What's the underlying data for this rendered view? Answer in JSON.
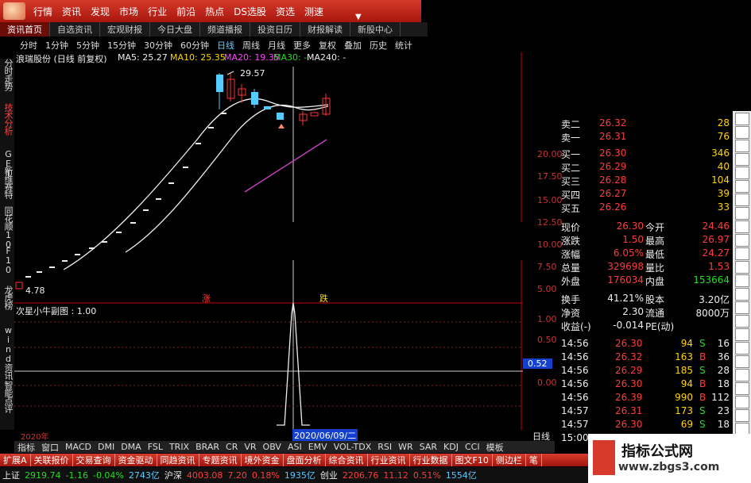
{
  "top_menu": [
    "行情",
    "资讯",
    "发现",
    "市场",
    "行业",
    "前沿",
    "热点",
    "DS选股",
    "资选",
    "测速"
  ],
  "tabs": [
    "资讯首页",
    "自选资讯",
    "宏观财报",
    "今日大盘",
    "频道播报",
    "投资日历",
    "财报解读",
    "新股中心"
  ],
  "toolbar": [
    "分时",
    "1分钟",
    "5分钟",
    "15分钟",
    "30分钟",
    "60分钟",
    "日线",
    "周线",
    "月线",
    "更多",
    "复权",
    "叠加",
    "历史",
    "统计"
  ],
  "toolbar_selected": "日线",
  "sidebar": [
    "分时走势",
    "技术分析",
    "GET",
    "新维赛特",
    "同花顺10",
    "F10",
    "龙虎榜",
    "wind资讯",
    "智能点评"
  ],
  "chart": {
    "stock_title": "浪瑞股份 (日线 前复权)",
    "ma5": "MA5: 25.27",
    "ma10": "MA10: 25.35",
    "ma20": "MA20: 19.35",
    "ma30": "MA30: -",
    "ma240": "MA240: -",
    "high_label": "29.57",
    "low_label": "4.78",
    "right_scale": [
      "20.00",
      "17.50",
      "15.00",
      "12.50",
      "10.00",
      "7.50",
      "5.00"
    ],
    "marker_up": "涨",
    "marker_down": "跌",
    "sub_title": "次星小牛副图 : 1.00",
    "sub_scale": [
      "1.00",
      "0.50",
      "0.00"
    ],
    "sub_value": "0.52",
    "date_left": "2020年",
    "date_cursor": "2020/06/09/二",
    "period_label": "日线"
  },
  "colors": {
    "up": "#ff3b3b",
    "down": "#22dd22",
    "ma10": "#ffd400",
    "ma20": "#ff44ff",
    "ma5": "#eeeeee",
    "brand": "#d63a2a"
  },
  "order_book": [
    {
      "label": "卖二",
      "price": "26.32",
      "vol": "28"
    },
    {
      "label": "卖一",
      "price": "26.31",
      "vol": "76"
    },
    {
      "label": "买一",
      "price": "26.30",
      "vol": "346"
    },
    {
      "label": "买二",
      "price": "26.29",
      "vol": "40"
    },
    {
      "label": "买三",
      "price": "26.28",
      "vol": "104"
    },
    {
      "label": "买四",
      "price": "26.27",
      "vol": "39"
    },
    {
      "label": "买五",
      "price": "26.26",
      "vol": "33"
    }
  ],
  "quote": [
    {
      "l1": "现价",
      "v1": "26.30",
      "l2": "今开",
      "v2": "24.46"
    },
    {
      "l1": "涨跌",
      "v1": "1.50",
      "l2": "最高",
      "v2": "26.97"
    },
    {
      "l1": "涨幅",
      "v1": "6.05%",
      "l2": "最低",
      "v2": "24.27"
    },
    {
      "l1": "总量",
      "v1": "329698",
      "l2": "量比",
      "v2": "1.53"
    },
    {
      "l1": "外盘",
      "v1": "176034",
      "l2": "内盘",
      "v2": "153664"
    }
  ],
  "fund": [
    {
      "l1": "换手",
      "v1": "41.21%",
      "l2": "股本",
      "v2": "3.20亿"
    },
    {
      "l1": "净资",
      "v1": "2.30",
      "l2": "流通",
      "v2": "8000万"
    },
    {
      "l1": "收益(-)",
      "v1": "-0.014",
      "l2": "PE(动)",
      "v2": ""
    }
  ],
  "ticks": [
    {
      "t": "14:56",
      "p": "26.30",
      "v": "94",
      "d": "S",
      "n": "16"
    },
    {
      "t": "14:56",
      "p": "26.32",
      "v": "163",
      "d": "B",
      "n": "36"
    },
    {
      "t": "14:56",
      "p": "26.29",
      "v": "185",
      "d": "S",
      "n": "28"
    },
    {
      "t": "14:56",
      "p": "26.30",
      "v": "94",
      "d": "B",
      "n": "18"
    },
    {
      "t": "14:56",
      "p": "26.39",
      "v": "990",
      "d": "B",
      "n": "112"
    },
    {
      "t": "14:57",
      "p": "26.31",
      "v": "173",
      "d": "S",
      "n": "23"
    },
    {
      "t": "14:57",
      "p": "26.30",
      "v": "69",
      "d": "S",
      "n": "18"
    },
    {
      "t": "15:00",
      "p": "",
      "v": "",
      "d": "",
      "n": ""
    }
  ],
  "bottom_tabs": [
    "指标",
    "窗口",
    "MACD",
    "DMI",
    "DMA",
    "FSL",
    "TRIX",
    "BRAR",
    "CR",
    "VR",
    "OBV",
    "ASI",
    "EMV",
    "VOL-TDX",
    "RSI",
    "WR",
    "SAR",
    "KDJ",
    "CCI",
    "模板"
  ],
  "bottom_links": [
    "扩展A",
    "关联报价",
    "交易查询",
    "资金驱动",
    "同趋资讯",
    "专题资讯",
    "境外资金",
    "盘面分析",
    "综合资讯",
    "行业资讯",
    "行业数据",
    "图文F10",
    "侧边栏",
    "笔"
  ],
  "index_bar": [
    {
      "name": "上证",
      "val": "2919.74",
      "chg": "-1.16",
      "pct": "-0.04%",
      "amt": "2743亿"
    },
    {
      "name": "沪深",
      "val": "4003.08",
      "chg": "7.20",
      "pct": "0.18%",
      "amt": "1935亿"
    },
    {
      "name": "创业",
      "val": "2206.76",
      "chg": "11.12",
      "pct": "0.51%",
      "amt": "1554亿"
    }
  ],
  "brand": {
    "name": "指标公式网",
    "url": "www.zbgs3.com"
  }
}
